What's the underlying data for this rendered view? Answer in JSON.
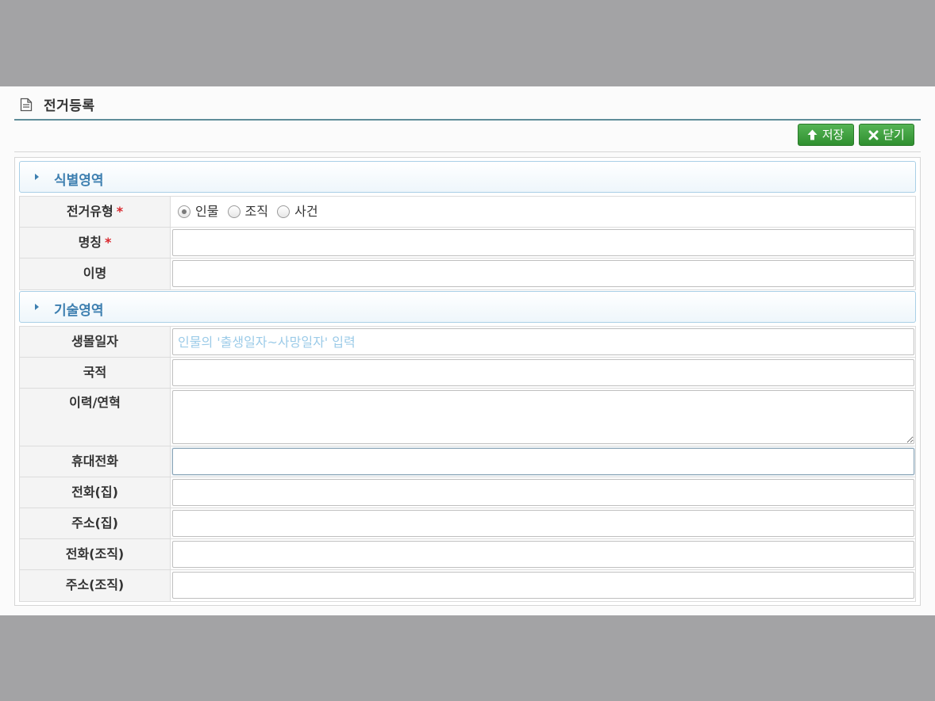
{
  "dialog": {
    "title": "전거등록",
    "title_icon": "document-icon"
  },
  "toolbar": {
    "save_label": "저장",
    "save_icon": "upload-arrow-icon",
    "close_label": "닫기",
    "close_icon": "close-x-icon"
  },
  "sections": {
    "identity": {
      "title": "식별영역",
      "fields": {
        "type": {
          "label": "전거유형",
          "required_mark": "*",
          "options": [
            "인물",
            "조직",
            "사건"
          ],
          "selected": "인물"
        },
        "name": {
          "label": "명칭",
          "required_mark": "*",
          "value": ""
        },
        "alias": {
          "label": "이명",
          "value": ""
        }
      }
    },
    "description": {
      "title": "기술영역",
      "fields": {
        "birth_death": {
          "label": "생몰일자",
          "placeholder": "인물의 '출생일자~사망일자' 입력",
          "value": ""
        },
        "nationality": {
          "label": "국적",
          "value": ""
        },
        "history": {
          "label": "이력/연혁",
          "value": ""
        },
        "mobile": {
          "label": "휴대전화",
          "value": ""
        },
        "phone_home": {
          "label": "전화(집)",
          "value": ""
        },
        "address_home": {
          "label": "주소(집)",
          "value": ""
        },
        "phone_org": {
          "label": "전화(조직)",
          "value": ""
        },
        "address_org": {
          "label": "주소(조직)",
          "value": ""
        }
      }
    }
  },
  "colors": {
    "accent": "#3d7fb0",
    "button_green": "#3a9a3a",
    "required": "#d9262c",
    "backdrop": "#a3a3a5"
  }
}
